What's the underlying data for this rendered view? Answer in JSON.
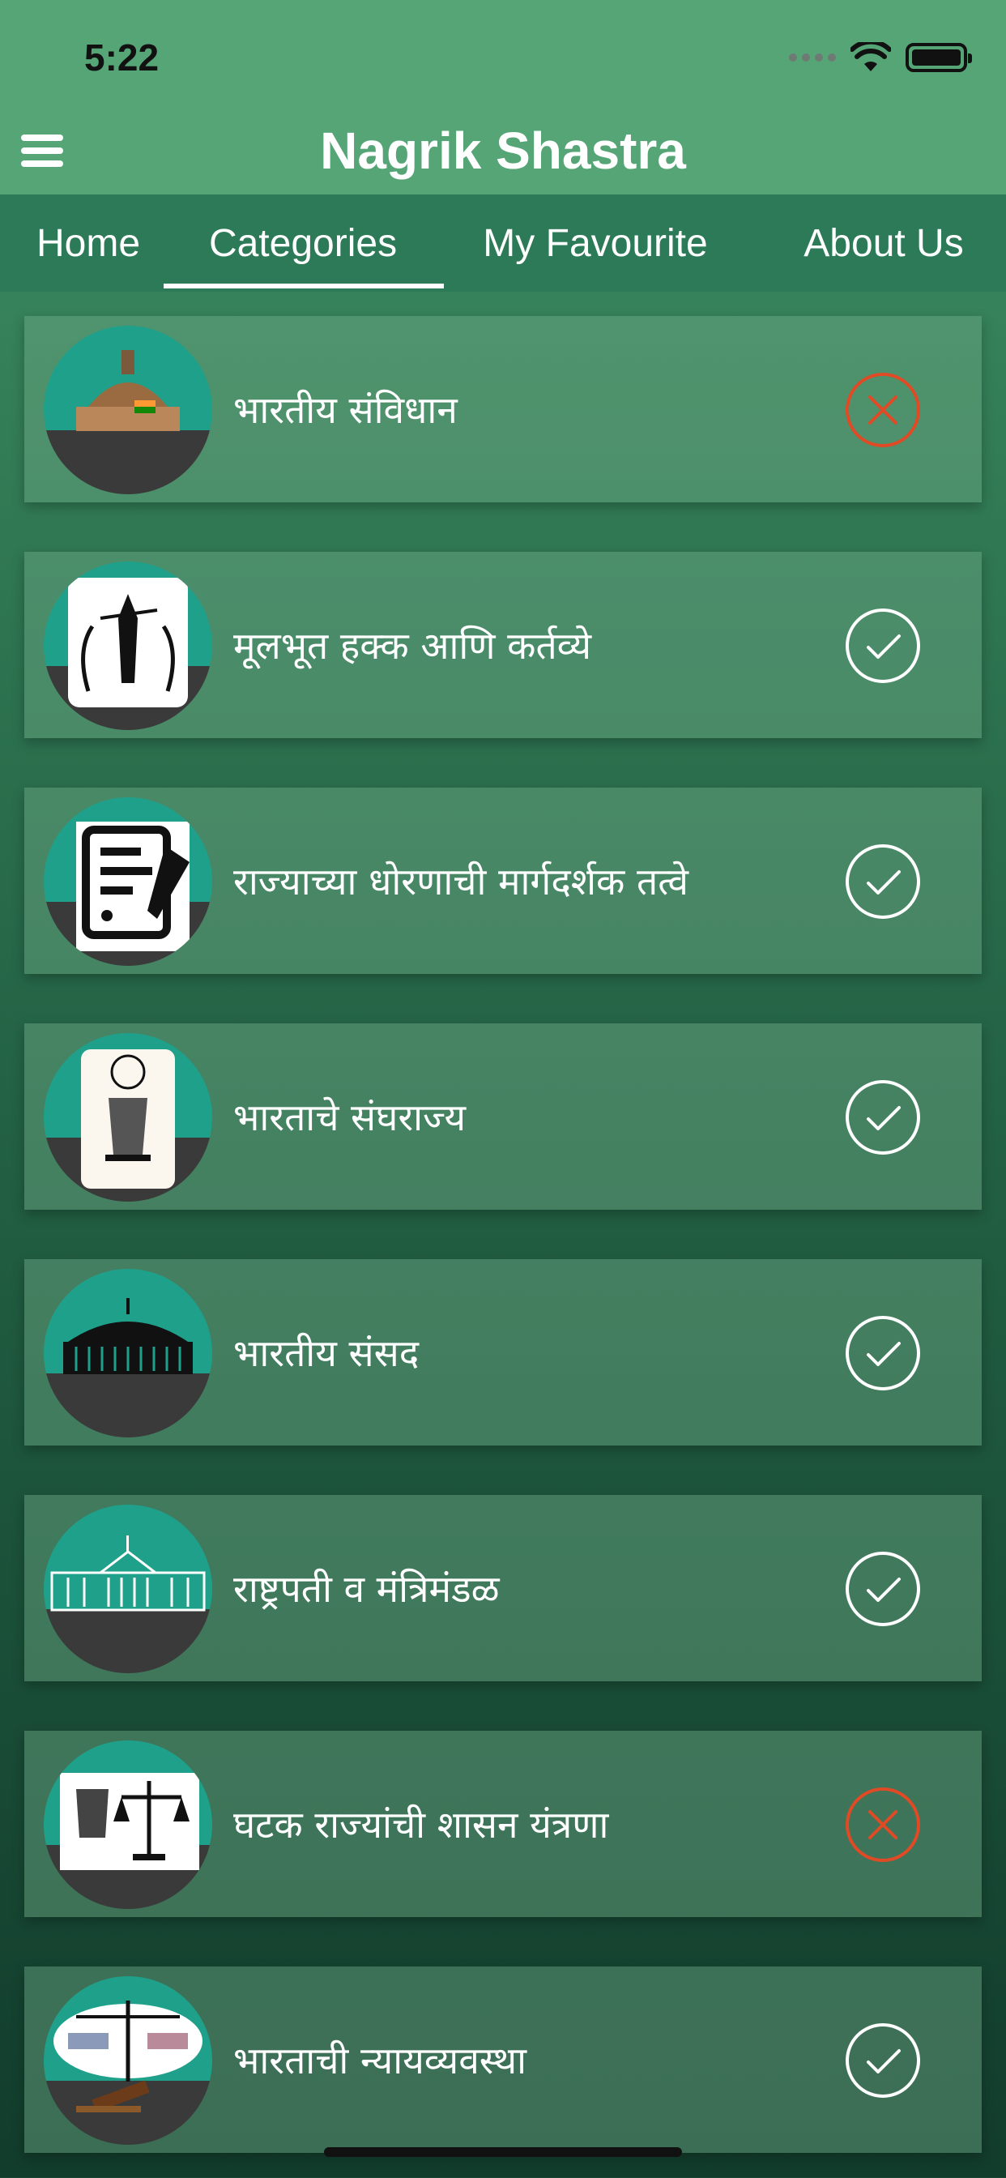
{
  "status_bar": {
    "time": "5:22"
  },
  "header": {
    "title": "Nagrik Shastra",
    "menu_icon": "hamburger-icon"
  },
  "tabs": [
    {
      "label": "Home",
      "active": false
    },
    {
      "label": "Categories",
      "active": true
    },
    {
      "label": "My Favourite",
      "active": false
    },
    {
      "label": "About Us",
      "active": false
    }
  ],
  "categories": [
    {
      "title": "भारतीय संविधान",
      "icon": "parliament-dome-icon",
      "status": "cross"
    },
    {
      "title": "मूलभूत हक्क आणि कर्तव्ये",
      "icon": "lady-justice-icon",
      "status": "check"
    },
    {
      "title": "राज्याच्या धोरणाची मार्गदर्शक तत्वे",
      "icon": "document-pen-icon",
      "status": "check"
    },
    {
      "title": "भारताचे संघराज्य",
      "icon": "ashoka-emblem-icon",
      "status": "check"
    },
    {
      "title": "भारतीय संसद",
      "icon": "parliament-building-icon",
      "status": "check"
    },
    {
      "title": "राष्ट्रपती व मंत्रिमंडळ",
      "icon": "president-house-icon",
      "status": "check"
    },
    {
      "title": "घटक राज्यांची शासन यंत्रणा",
      "icon": "emblem-scales-icon",
      "status": "cross"
    },
    {
      "title": "भारताची न्यायव्यवस्था",
      "icon": "judiciary-scales-icon",
      "status": "check"
    }
  ],
  "colors": {
    "accent_green": "#56a577",
    "tab_bar": "#2c7a57",
    "cross": "#e04a25",
    "check": "#ffffff"
  }
}
